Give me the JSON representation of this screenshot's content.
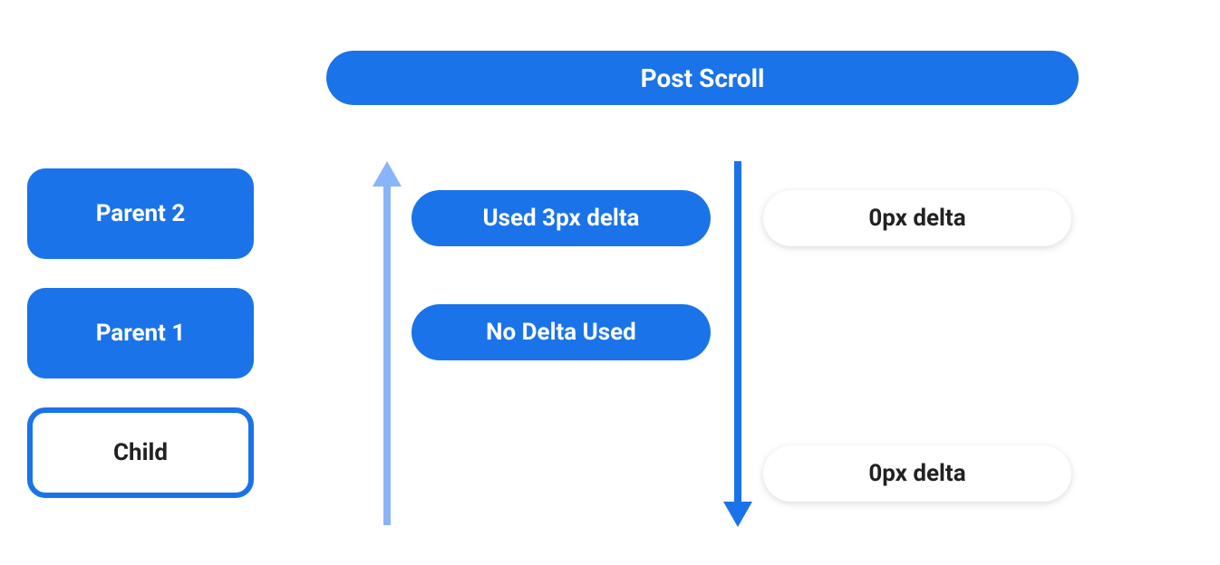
{
  "header": {
    "title": "Post Scroll"
  },
  "hierarchy": {
    "parent2": "Parent 2",
    "parent1": "Parent 1",
    "child": "Child"
  },
  "upflow": {
    "used_3px": "Used 3px delta",
    "no_delta": "No Delta Used"
  },
  "downflow": {
    "delta_0_top": "0px delta",
    "delta_0_bottom": "0px delta"
  },
  "colors": {
    "primary_blue": "#1a73e8",
    "light_blue": "#8ab4f8",
    "white": "#ffffff",
    "text_dark": "#212121"
  }
}
